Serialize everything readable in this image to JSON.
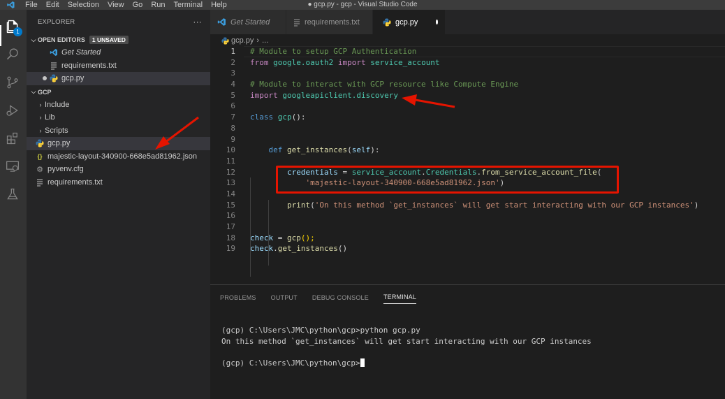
{
  "window": {
    "title": "● gcp.py - gcp - Visual Studio Code"
  },
  "menu": [
    "File",
    "Edit",
    "Selection",
    "View",
    "Go",
    "Run",
    "Terminal",
    "Help"
  ],
  "activity": {
    "explorer_badge": "1"
  },
  "sidebar": {
    "title": "EXPLORER",
    "more": "···",
    "open_editors_label": "OPEN EDITORS",
    "unsaved_badge": "1 UNSAVED",
    "open_editors": [
      {
        "name": "Get Started",
        "icon": "vscode-icon"
      },
      {
        "name": "requirements.txt",
        "icon": "text-file-icon"
      },
      {
        "name": "gcp.py",
        "icon": "python-icon"
      }
    ],
    "folder_label": "GCP",
    "tree": [
      {
        "name": "Include",
        "type": "folder"
      },
      {
        "name": "Lib",
        "type": "folder"
      },
      {
        "name": "Scripts",
        "type": "folder"
      },
      {
        "name": "gcp.py",
        "type": "python"
      },
      {
        "name": "majestic-layout-340900-668e5ad81962.json",
        "type": "json"
      },
      {
        "name": "pyvenv.cfg",
        "type": "config"
      },
      {
        "name": "requirements.txt",
        "type": "text"
      }
    ]
  },
  "tabs": [
    {
      "label": "Get Started",
      "active": false
    },
    {
      "label": "requirements.txt",
      "active": false
    },
    {
      "label": "gcp.py",
      "active": true
    }
  ],
  "breadcrumb": {
    "file": "gcp.py",
    "rest": "..."
  },
  "code": {
    "line_numbers": [
      "1",
      "2",
      "3",
      "4",
      "5",
      "6",
      "7",
      "8",
      "9",
      "10",
      "11",
      "12",
      "13",
      "14",
      "15",
      "16",
      "17",
      "18",
      "19"
    ],
    "l1": "# Module to setup GCP Authentication",
    "l2_kw": "from",
    "l2_mod": "google.oauth2",
    "l2_kw2": "import",
    "l2_name": "service_account",
    "l4": "# Module to interact with GCP resource like Compute Engine",
    "l5_kw": "import",
    "l5_mod": "googleapiclient.discovery",
    "l7_kw": "class",
    "l7_name": "gcp",
    "l7_rest": "():",
    "l10_kw": "def",
    "l10_fn": "get_instances",
    "l10_p1": "(",
    "l10_self": "self",
    "l10_p2": "):",
    "l12_var": "credentials",
    "l12_eq": " = ",
    "l12_mod": "service_account",
    "l12_dot1": ".",
    "l12_cls": "Credentials",
    "l12_dot2": ".",
    "l12_fn": "from_service_account_file",
    "l12_par": "(",
    "l13_str": "'majestic-layout-340900-668e5ad81962.json'",
    "l13_par": ")",
    "l15_fn": "print",
    "l15_p1": "(",
    "l15_str": "'On this method `get_instances` will get start interacting with our GCP instances'",
    "l15_p2": ")",
    "l18_var": "check",
    "l18_eq": " = ",
    "l18_fn": "gcp",
    "l18_rest": "();",
    "l19_var": "check",
    "l19_dot": ".",
    "l19_fn": "get_instances",
    "l19_rest": "()"
  },
  "panel": {
    "tabs": [
      "PROBLEMS",
      "OUTPUT",
      "DEBUG CONSOLE",
      "TERMINAL"
    ],
    "active_tab": "TERMINAL",
    "terminal_lines": [
      "(gcp) C:\\Users\\JMC\\python\\gcp>python gcp.py",
      "On this method `get_instances` will get start interacting with our GCP instances",
      "",
      "(gcp) C:\\Users\\JMC\\python\\gcp>"
    ]
  },
  "colors": {
    "annotation": "#e51400",
    "accent": "#007acc"
  }
}
